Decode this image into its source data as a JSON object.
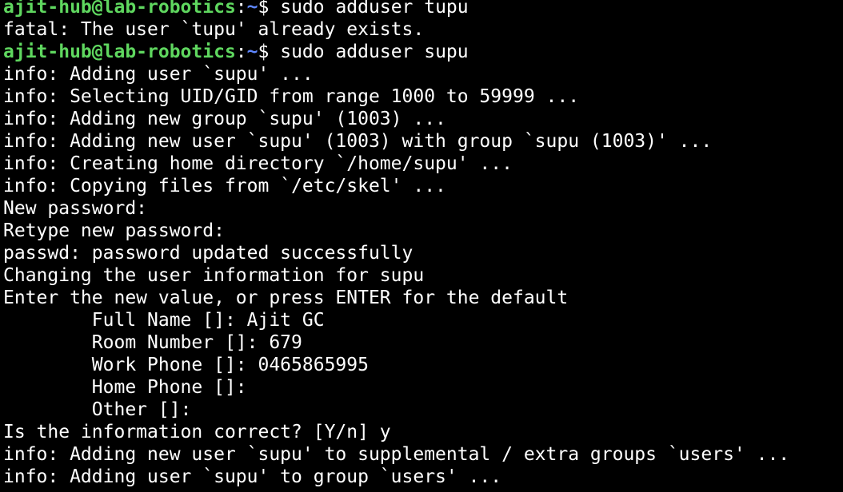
{
  "prompt": {
    "user_host": "ajit-hub@lab-robotics",
    "colon": ":",
    "path": "~",
    "symbol": "$ "
  },
  "lines": [
    {
      "type": "prompt",
      "command": "sudo adduser tupu"
    },
    {
      "type": "output",
      "text": "fatal: The user `tupu' already exists."
    },
    {
      "type": "prompt",
      "command": "sudo adduser supu"
    },
    {
      "type": "output",
      "text": "info: Adding user `supu' ..."
    },
    {
      "type": "output",
      "text": "info: Selecting UID/GID from range 1000 to 59999 ..."
    },
    {
      "type": "output",
      "text": "info: Adding new group `supu' (1003) ..."
    },
    {
      "type": "output",
      "text": "info: Adding new user `supu' (1003) with group `supu (1003)' ..."
    },
    {
      "type": "output",
      "text": "info: Creating home directory `/home/supu' ..."
    },
    {
      "type": "output",
      "text": "info: Copying files from `/etc/skel' ..."
    },
    {
      "type": "output",
      "text": "New password:"
    },
    {
      "type": "output",
      "text": "Retype new password:"
    },
    {
      "type": "output",
      "text": "passwd: password updated successfully"
    },
    {
      "type": "output",
      "text": "Changing the user information for supu"
    },
    {
      "type": "output",
      "text": "Enter the new value, or press ENTER for the default"
    },
    {
      "type": "output",
      "text": "        Full Name []: Ajit GC"
    },
    {
      "type": "output",
      "text": "        Room Number []: 679"
    },
    {
      "type": "output",
      "text": "        Work Phone []: 0465865995"
    },
    {
      "type": "output",
      "text": "        Home Phone []:"
    },
    {
      "type": "output",
      "text": "        Other []:"
    },
    {
      "type": "output",
      "text": "Is the information correct? [Y/n] y"
    },
    {
      "type": "output",
      "text": "info: Adding new user `supu' to supplemental / extra groups `users' ..."
    },
    {
      "type": "output",
      "text": "info: Adding user `supu' to group `users' ..."
    }
  ],
  "colors": {
    "background": "#000000",
    "text": "#ffffff",
    "prompt_user": "#5fd75f",
    "prompt_path": "#5f87ff"
  }
}
